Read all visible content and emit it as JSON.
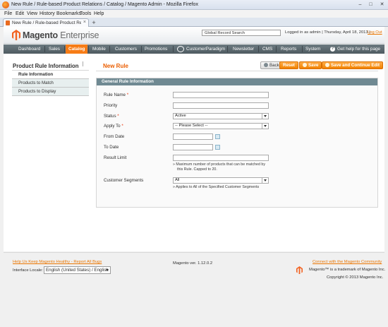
{
  "browser": {
    "window_title": "New Rule / Rule-based Product Relations / Catalog / Magento Admin - Mozilla Firefox",
    "menu": [
      "File",
      "Edit",
      "View",
      "History",
      "Bookmarks",
      "Tools",
      "Help"
    ],
    "tab_label": "New Rule / Rule-based Product Relations / ...",
    "new_tab": "+",
    "win_buttons": {
      "minimize": "–",
      "maximize": "□",
      "close": "✕"
    }
  },
  "header": {
    "logo_brand": "Magento",
    "logo_edition": "Enterprise",
    "search_value": "Global Record Search",
    "user_info": "Logged in as admin  |  Thursday, April 18, 2013  |",
    "logout": "Log Out"
  },
  "nav": {
    "items": [
      "Dashboard",
      "Sales",
      "Catalog",
      "Mobile",
      "Customers",
      "Promotions",
      "CustomerParadigm",
      "Newsletter",
      "CMS",
      "Reports",
      "System"
    ],
    "help": "Get help for this page",
    "active_index": 2
  },
  "sidebar": {
    "title": "Product Rule Information",
    "tabs": [
      "Rule Information",
      "Products to Match",
      "Products to Display"
    ]
  },
  "content": {
    "page_title": "New Rule",
    "buttons": {
      "back": "Back",
      "reset": "Reset",
      "save": "Save",
      "save_continue": "Save and Continue Edit"
    },
    "fieldset_title": "General Rule Information",
    "fields": {
      "rule_name": {
        "label": "Rule Name",
        "required": "*",
        "value": ""
      },
      "priority": {
        "label": "Priority",
        "value": ""
      },
      "status": {
        "label": "Status",
        "required": "*",
        "value": "Active"
      },
      "apply_to": {
        "label": "Apply To",
        "required": "*",
        "value": "-- Please Select --"
      },
      "from_date": {
        "label": "From Date",
        "value": ""
      },
      "to_date": {
        "label": "To Date",
        "value": ""
      },
      "result_limit": {
        "label": "Result Limit",
        "value": "",
        "note_line1": "Maximum number of products that can be matched by",
        "note_line2": "this Rule. Capped to 20."
      },
      "customer_segments": {
        "label": "Customer Segments",
        "value": "All",
        "note": "Applies to All of the Specified Customer Segments"
      }
    }
  },
  "footer": {
    "bug_link": "Help Us Keep Magento Healthy - Report All Bugs",
    "locale_label": "Interface Locale:",
    "locale_value": "English (United States) / English",
    "version": "Magento ver. 1.12.0.2",
    "connect_link": "Connect with the Magento Community",
    "trademark": "Magento™ is a trademark of Magento Inc.",
    "copyright": "Copyright © 2013 Magento Inc."
  },
  "colors": {
    "accent": "#eb5e00",
    "nav_bg": "#5a676d",
    "button_orange": "#f18200",
    "fieldset_head": "#6f8992"
  }
}
